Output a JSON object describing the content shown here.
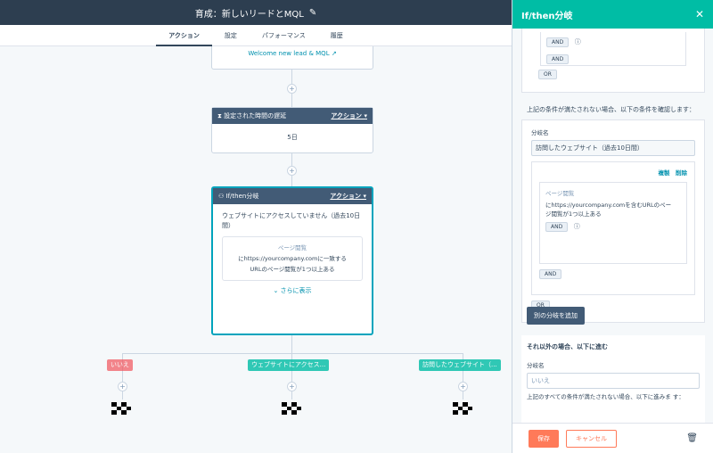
{
  "topbar": {
    "title": "育成：新しいリードとMQL",
    "edit_icon": "✎"
  },
  "tabs": [
    {
      "label": "アクション",
      "active": true
    },
    {
      "label": "設定"
    },
    {
      "label": "パフォーマンス"
    },
    {
      "label": "履歴"
    }
  ],
  "canvas": {
    "welcome_link": "Welcome new lead & MQL ↗",
    "delay_card": {
      "header": "設定された時間の遅延",
      "action": "アクション ▾",
      "value": "5日"
    },
    "ifthen_card": {
      "header": "If/then分岐",
      "action": "アクション ▾",
      "branch_title": "ウェブサイトにアクセスしていません（過去10日間）",
      "sub_title": "ページ閲覧",
      "sub_line1": "にhttps://yourcompany.comに一致する",
      "sub_line2": "URLのページ閲覧が1つ以上ある",
      "more": "さらに表示"
    },
    "branches": [
      {
        "label": "いいえ"
      },
      {
        "label": "ウェブサイトにアクセス..."
      },
      {
        "label": "訪問したウェブサイト（..."
      }
    ]
  },
  "panel": {
    "title": "If/then分岐",
    "and_label": "AND",
    "or_label": "OR",
    "section_heading": "上記の条件が満たされない場合、以下の条件を確認します：",
    "branch_name_label": "分岐名",
    "branch_name_value": "訪問したウェブサイト（過去10日間）",
    "copy_link": "複製",
    "delete_link": "削除",
    "filter_title": "ページ閲覧",
    "filter_line1": "にhttps://yourcompany.comを含むURLのペー",
    "filter_line2": "ジ閲覧が1つ以上ある",
    "add_branch": "別の分岐を追加",
    "else_heading": "それ以外の場合、以下に進む",
    "else_name_label": "分岐名",
    "else_name_value": "いいえ",
    "else_note": "上記のすべての条件が満たされない場合、以下に進みま す：",
    "save": "保存",
    "cancel": "キャンセル"
  }
}
